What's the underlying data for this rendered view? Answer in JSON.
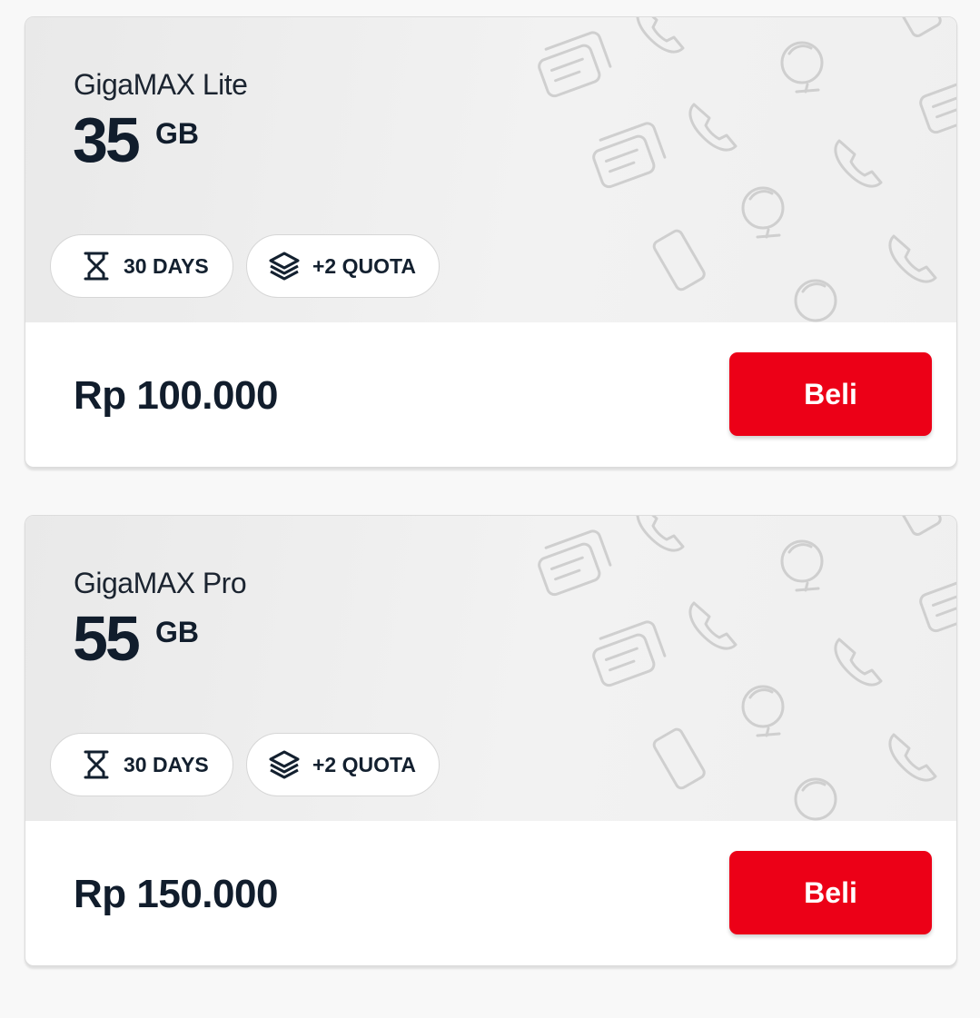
{
  "packages": [
    {
      "name": "GigaMAX Lite",
      "quota_amount": "35",
      "quota_unit": "GB",
      "duration_label": "30 DAYS",
      "bonus_label": "+2 QUOTA",
      "price": "Rp 100.000",
      "buy_label": "Beli"
    },
    {
      "name": "GigaMAX Pro",
      "quota_amount": "55",
      "quota_unit": "GB",
      "duration_label": "30 DAYS",
      "bonus_label": "+2 QUOTA",
      "price": "Rp 150.000",
      "buy_label": "Beli"
    }
  ],
  "icons": {
    "duration": "hourglass-icon",
    "bonus": "layers-icon",
    "pattern": [
      "chat-icon",
      "phone-icon",
      "globe-icon",
      "smartphone-icon"
    ]
  },
  "colors": {
    "accent": "#ec0017",
    "text_dark": "#111d2c",
    "card_top_bg": "#eeeeee"
  }
}
